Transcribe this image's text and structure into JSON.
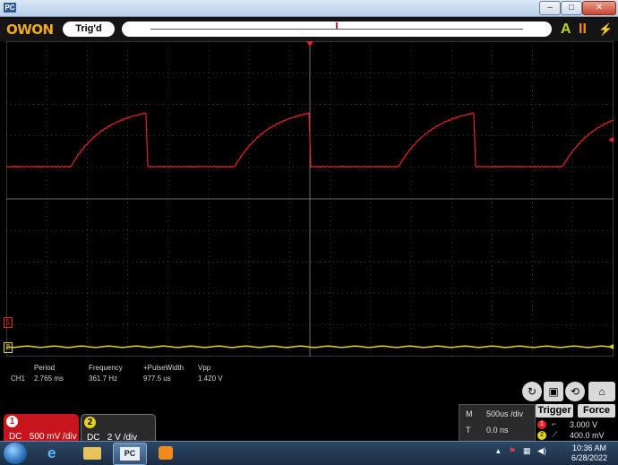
{
  "window": {
    "icon_label": "PC",
    "minimize": "–",
    "maximize": "□",
    "close": "✕"
  },
  "toolbar": {
    "logo": "OWON",
    "trigger_status": "Trig'd",
    "auto_label": "A",
    "pause_label": "II",
    "run_label": "⚡"
  },
  "colors": {
    "ch1": "#e8222b",
    "ch2": "#e6d219",
    "grid": "#5a5a5a",
    "accent": "#f2a91d"
  },
  "measurements": {
    "channel": "CH1",
    "headers": [
      "Period",
      "Frequency",
      "+PulseWidth",
      "Vpp"
    ],
    "values": [
      "2.765 ms",
      "361.7 Hz",
      "977.5 us",
      "1.420 V"
    ]
  },
  "markers": {
    "ch1_marker": "1",
    "ch2_marker": "2"
  },
  "channels": [
    {
      "number": "1",
      "coupling": "DC",
      "scale": "500 mV /div"
    },
    {
      "number": "2",
      "coupling": "DC",
      "scale": "2 V /div"
    }
  ],
  "timebase": {
    "m_label": "M",
    "m_value": "500us /div",
    "t_label": "T",
    "t_value": "0.0 ns"
  },
  "trigger": {
    "trigger_button": "Trigger",
    "force_button": "Force",
    "source": "1",
    "level": "3.000 V",
    "ch2_marker": "2",
    "offset": "400.0 mV"
  },
  "taskbar": {
    "time": "10:36 AM",
    "date": "6/28/2022",
    "pc_app": "PC"
  },
  "icons": [
    "home-icon",
    "save-icon",
    "refresh-icon",
    "autoset-icon"
  ]
}
